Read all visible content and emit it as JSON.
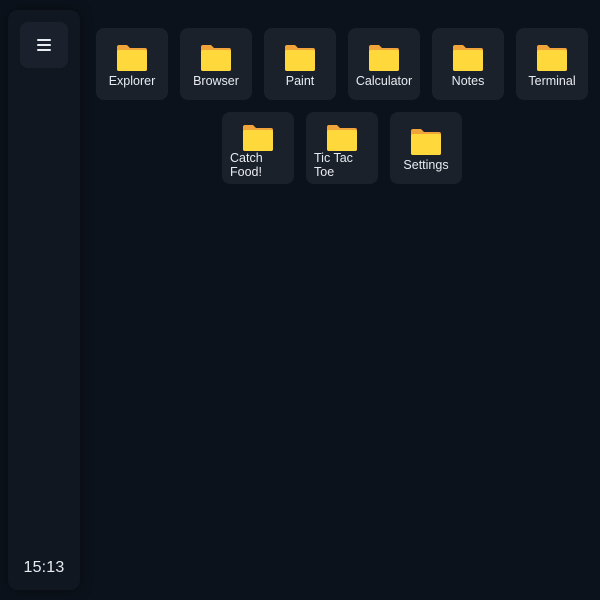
{
  "sidebar": {
    "menu_icon": "hamburger-menu-icon",
    "clock": "15:13"
  },
  "desktop": {
    "folder_icon": "folder-icon",
    "folder_colors": {
      "front": "#ffd83b",
      "back": "#f0a43a",
      "edge": "#e0962e"
    },
    "row1": [
      {
        "label": "Explorer"
      },
      {
        "label": "Browser"
      },
      {
        "label": "Paint"
      },
      {
        "label": "Calculator"
      },
      {
        "label": "Notes"
      },
      {
        "label": "Terminal"
      }
    ],
    "row2": [
      {
        "label": "Catch Food!"
      },
      {
        "label": "Tic Tac Toe"
      },
      {
        "label": "Settings"
      }
    ]
  }
}
